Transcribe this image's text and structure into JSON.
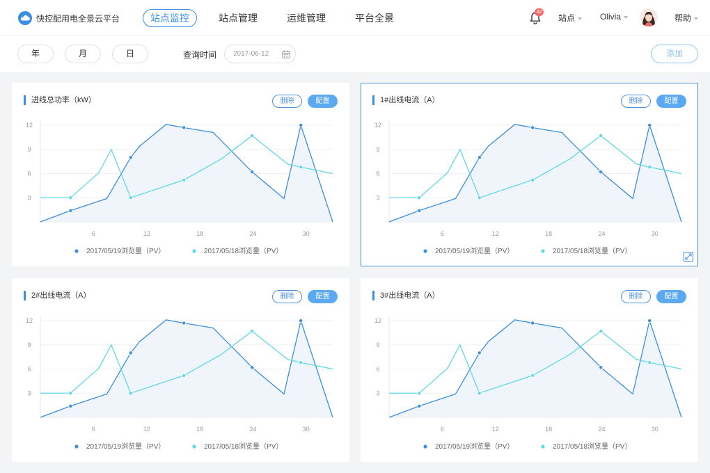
{
  "app": {
    "title": "快控配用电全景云平台",
    "nav": [
      "站点监控",
      "站点管理",
      "运维管理",
      "平台全景"
    ],
    "notification_count": "32",
    "site_label": "站点",
    "user_name": "Olivia",
    "help_label": "帮助"
  },
  "filters": {
    "periods": [
      "年",
      "月",
      "日"
    ],
    "query_label": "查询时间",
    "date_value": "2017-06-12",
    "add_label": "添加"
  },
  "panel_buttons": {
    "delete": "删除",
    "config": "配置"
  },
  "colors": {
    "accent": "#3a8ee6",
    "series1": "#3b8fde",
    "series2": "#5fd8e6",
    "area": "#eef3fb"
  },
  "panels": [
    {
      "title": "进线总功率（kW）"
    },
    {
      "title": "1#出线电流（A）"
    },
    {
      "title": "2#出线电流（A）"
    },
    {
      "title": "3#出线电流（A）"
    }
  ],
  "chart_data": [
    {
      "type": "line",
      "title": "进线总功率（kW）",
      "x_ticks": [
        6,
        12,
        18,
        24,
        30
      ],
      "y_ticks": [
        3,
        6,
        9,
        12
      ],
      "xlim": [
        0,
        33
      ],
      "ylim": [
        0,
        12
      ],
      "legend_position": "bottom",
      "series": [
        {
          "name": "2017/05/19浏览量（PV）",
          "x": [
            0,
            3.4,
            7.5,
            10.2,
            11.2,
            14.2,
            16.2,
            19.5,
            23.9,
            27.5,
            29.4,
            33
          ],
          "y": [
            0,
            1.4,
            2.9,
            8,
            9.4,
            12.1,
            11.7,
            11.1,
            6.2,
            2.9,
            12,
            0
          ],
          "markers": [
            1,
            3,
            6,
            8,
            10
          ]
        },
        {
          "name": "2017/05/18浏览量（PV）",
          "x": [
            0,
            3.4,
            6.6,
            8,
            10.2,
            16.2,
            20.4,
            23.9,
            27.9,
            29.4,
            33
          ],
          "y": [
            3,
            3,
            6.1,
            9,
            3,
            5.2,
            7.8,
            10.7,
            7.2,
            6.8,
            6
          ],
          "markers": [
            1,
            4,
            5,
            7,
            9
          ]
        }
      ]
    },
    {
      "type": "line",
      "title": "1#出线电流（A）",
      "x_ticks": [
        6,
        12,
        18,
        24,
        30
      ],
      "y_ticks": [
        3,
        6,
        9,
        12
      ],
      "xlim": [
        0,
        33
      ],
      "ylim": [
        0,
        12
      ],
      "legend_position": "bottom",
      "series": [
        {
          "name": "2017/05/19浏览量（PV）",
          "x": [
            0,
            3.4,
            7.5,
            10.2,
            11.2,
            14.2,
            16.2,
            19.5,
            23.9,
            27.5,
            29.4,
            33
          ],
          "y": [
            0,
            1.4,
            2.9,
            8,
            9.4,
            12.1,
            11.7,
            11.1,
            6.2,
            2.9,
            12,
            0
          ],
          "markers": [
            1,
            3,
            6,
            8,
            10
          ]
        },
        {
          "name": "2017/05/18浏览量（PV）",
          "x": [
            0,
            3.4,
            6.6,
            8,
            10.2,
            16.2,
            20.4,
            23.9,
            27.9,
            29.4,
            33
          ],
          "y": [
            3,
            3,
            6.1,
            9,
            3,
            5.2,
            7.8,
            10.7,
            7.2,
            6.8,
            6
          ],
          "markers": [
            1,
            4,
            5,
            7,
            9
          ]
        }
      ]
    },
    {
      "type": "line",
      "title": "2#出线电流（A）",
      "x_ticks": [
        6,
        12,
        18,
        24,
        30
      ],
      "y_ticks": [
        3,
        6,
        9,
        12
      ],
      "xlim": [
        0,
        33
      ],
      "ylim": [
        0,
        12
      ],
      "legend_position": "bottom",
      "series": [
        {
          "name": "2017/05/19浏览量（PV）",
          "x": [
            0,
            3.4,
            7.5,
            10.2,
            11.2,
            14.2,
            16.2,
            19.5,
            23.9,
            27.5,
            29.4,
            33
          ],
          "y": [
            0,
            1.4,
            2.9,
            8,
            9.4,
            12.1,
            11.7,
            11.1,
            6.2,
            2.9,
            12,
            0
          ],
          "markers": [
            1,
            3,
            6,
            8,
            10
          ]
        },
        {
          "name": "2017/05/18浏览量（PV）",
          "x": [
            0,
            3.4,
            6.6,
            8,
            10.2,
            16.2,
            20.4,
            23.9,
            27.9,
            29.4,
            33
          ],
          "y": [
            3,
            3,
            6.1,
            9,
            3,
            5.2,
            7.8,
            10.7,
            7.2,
            6.8,
            6
          ],
          "markers": [
            1,
            4,
            5,
            7,
            9
          ]
        }
      ]
    },
    {
      "type": "line",
      "title": "3#出线电流（A）",
      "x_ticks": [
        6,
        12,
        18,
        24,
        30
      ],
      "y_ticks": [
        3,
        6,
        9,
        12
      ],
      "xlim": [
        0,
        33
      ],
      "ylim": [
        0,
        12
      ],
      "legend_position": "bottom",
      "series": [
        {
          "name": "2017/05/19浏览量（PV）",
          "x": [
            0,
            3.4,
            7.5,
            10.2,
            11.2,
            14.2,
            16.2,
            19.5,
            23.9,
            27.5,
            29.4,
            33
          ],
          "y": [
            0,
            1.4,
            2.9,
            8,
            9.4,
            12.1,
            11.7,
            11.1,
            6.2,
            2.9,
            12,
            0
          ],
          "markers": [
            1,
            3,
            6,
            8,
            10
          ]
        },
        {
          "name": "2017/05/18浏览量（PV）",
          "x": [
            0,
            3.4,
            6.6,
            8,
            10.2,
            16.2,
            20.4,
            23.9,
            27.9,
            29.4,
            33
          ],
          "y": [
            3,
            3,
            6.1,
            9,
            3,
            5.2,
            7.8,
            10.7,
            7.2,
            6.8,
            6
          ],
          "markers": [
            1,
            4,
            5,
            7,
            9
          ]
        }
      ]
    }
  ]
}
